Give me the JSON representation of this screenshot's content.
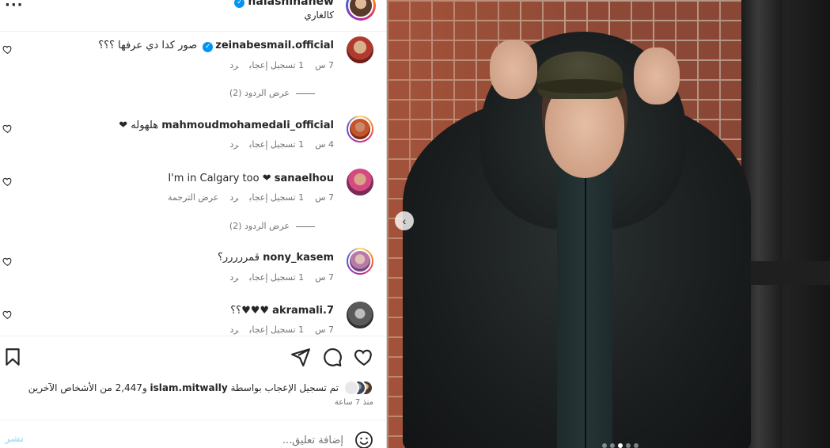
{
  "post": {
    "author": "halashihanew",
    "caption": "كالغاري",
    "more_label": "···"
  },
  "comments": [
    {
      "username": "zeinabesmail.official",
      "verified": true,
      "text": "صور كدا دي عرفها ؟؟؟",
      "time": "7 س",
      "likes": "1 تسجيل إعجاب",
      "reply": "رد",
      "translate": "",
      "replies": "عرض الردود (2)"
    },
    {
      "username": "mahmoudmohamedali_official",
      "verified": false,
      "text": "هلهوله ❤",
      "time": "4 س",
      "likes": "1 تسجيل إعجاب",
      "reply": "رد",
      "translate": "",
      "replies": ""
    },
    {
      "username": "sanaelhou",
      "verified": false,
      "text": "I'm in Calgary too ❤",
      "time": "7 س",
      "likes": "1 تسجيل إعجاب",
      "reply": "رد",
      "translate": "عرض الترجمة",
      "replies": "عرض الردود (2)"
    },
    {
      "username": "nony_kasem",
      "verified": false,
      "text": "قمررررر؟",
      "time": "7 س",
      "likes": "1 تسجيل إعجاب",
      "reply": "رد",
      "translate": "",
      "replies": ""
    },
    {
      "username": "akramali.7",
      "verified": false,
      "text": "♥♥♥؟؟",
      "time": "7 س",
      "likes": "1 تسجيل إعجاب",
      "reply": "رد",
      "translate": "",
      "replies": ""
    }
  ],
  "likes": {
    "text_prefix": "تم تسجيل الإعجاب بواسطة ",
    "liked_by": "islam.mitwally",
    "text_suffix": " و2,447 من الأشخاص الآخرين",
    "time_ago": "منذ 7 ساعة"
  },
  "add_comment": {
    "placeholder": "إضافة تعليق...",
    "post_label": "نشر"
  },
  "carousel": {
    "active_index": 2,
    "count": 5
  },
  "colors": {
    "verified": "#0095f6",
    "post_disabled": "#b2dffc",
    "meta_text": "#737373"
  }
}
